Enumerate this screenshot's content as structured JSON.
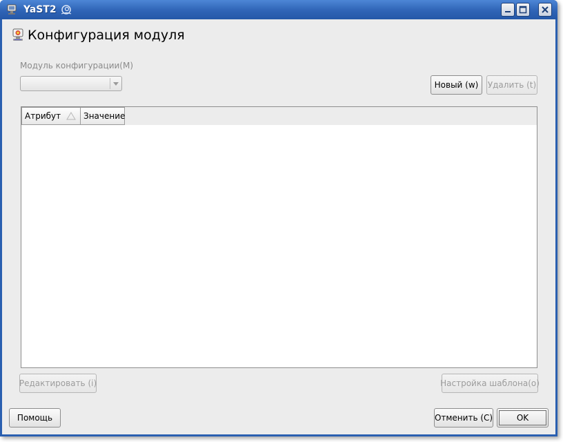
{
  "window": {
    "title": "YaST2",
    "controls": [
      "minimize-icon",
      "maximize-icon",
      "close-icon"
    ]
  },
  "page": {
    "heading": "Конфигурация модуля",
    "module_label": "Модуль конфигурации(M)",
    "module_combo_value": ""
  },
  "toolbar": {
    "new_label": "Новый (w)",
    "delete_label": "Удалить (t)"
  },
  "table": {
    "columns": [
      "Атрибут",
      "Значение"
    ],
    "sorted_column": "Атрибут",
    "rows": []
  },
  "actions": {
    "edit_label": "Редактировать (i)",
    "template_label": "Настройка шаблона(o)"
  },
  "footer": {
    "help_label": "Помощь",
    "cancel_label": "Отменить (C)",
    "ok_label": "OK"
  },
  "colors": {
    "titlebar": "#2f64b6",
    "client_bg": "#ececec",
    "disabled_text": "#9c9c9c"
  }
}
